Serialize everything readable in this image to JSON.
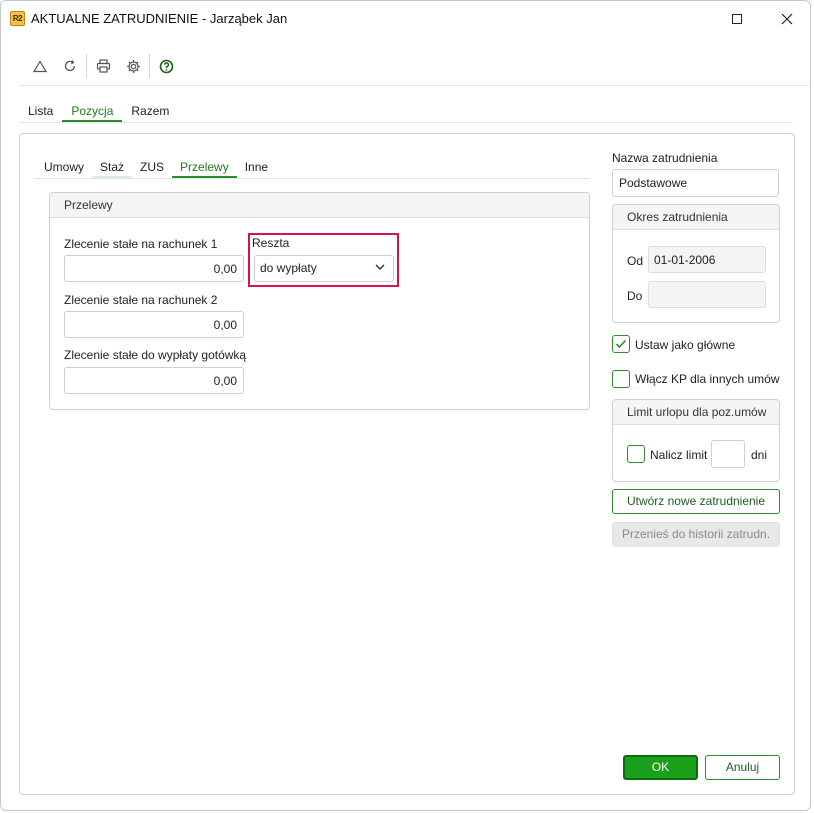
{
  "window": {
    "logo_text": "R2",
    "title": "AKTUALNE ZATRUDNIENIE - Jarząbek Jan"
  },
  "toolbar": {
    "icons": [
      "triangle-icon",
      "refresh-icon",
      "print-icon",
      "gear-icon",
      "help-icon"
    ]
  },
  "top_tabs": [
    {
      "label": "Lista",
      "active": false
    },
    {
      "label": "Pozycja",
      "active": true
    },
    {
      "label": "Razem",
      "active": false
    }
  ],
  "sub_tabs": [
    {
      "label": "Umowy",
      "active": false
    },
    {
      "label": "Staż",
      "active": false
    },
    {
      "label": "ZUS",
      "active": false
    },
    {
      "label": "Przelewy",
      "active": true
    },
    {
      "label": "Inne",
      "active": false
    }
  ],
  "przelewy": {
    "group_title": "Przelewy",
    "field1_label": "Zlecenie stałe na rachunek 1",
    "field1_value": "0,00",
    "field2_label": "Zlecenie stałe na rachunek 2",
    "field2_value": "0,00",
    "field3_label": "Zlecenie stałe do wypłaty gotówką",
    "field3_value": "0,00",
    "reszta_label": "Reszta",
    "reszta_value": "do wypłaty"
  },
  "right": {
    "nazwa_label": "Nazwa zatrudnienia",
    "nazwa_value": "Podstawowe",
    "okres_title": "Okres zatrudnienia",
    "od_label": "Od",
    "od_value": "01-01-2006",
    "do_label": "Do",
    "do_value": "",
    "ustaw_label": "Ustaw jako główne",
    "ustaw_checked": true,
    "wlacz_label": "Włącz KP dla innych umów",
    "wlacz_checked": false,
    "limit_title": "Limit urlopu dla poz.umów",
    "nalicz_label": "Nalicz limit",
    "nalicz_checked": false,
    "dni_value": "",
    "dni_label": "dni",
    "create_button": "Utwórz nowe zatrudnienie",
    "move_button": "Przenieś do historii zatrudn."
  },
  "footer": {
    "ok_label": "OK",
    "cancel_label": "Anuluj"
  },
  "colors": {
    "accent": "#2e8b2e",
    "ok_button": "#1aa01a",
    "highlight": "#d8124c"
  }
}
